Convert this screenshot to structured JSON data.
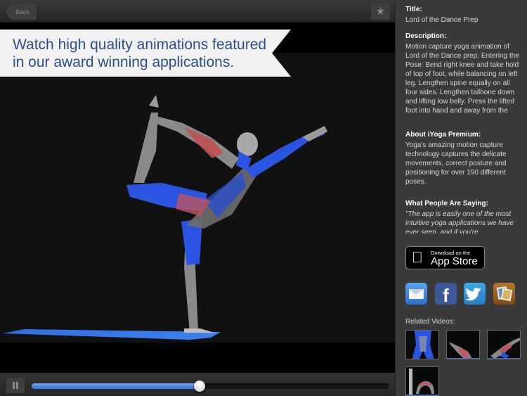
{
  "topbar": {
    "back_label": "Back",
    "favorite_icon": "star-icon",
    "favorite_glyph": "★"
  },
  "banner": {
    "text": "Watch high quality animations featured in our award winning applications."
  },
  "player": {
    "pause_icon": "pause-icon",
    "progress_fraction": 0.47,
    "progress_fill_color": "#4a80e0"
  },
  "info": {
    "title_label": "Title:",
    "title_value": "Lord of the Dance Prep",
    "description_label": "Description:",
    "description_value": "Motion capture yoga animation of Lord of the Dance prep. Entering the Pose: Bend right knee and take hold of top of foot, while balancing on left leg. Lengthen spine equally on all four sides. Lengthen tailbone down and lifting low belly. Press the lifted foot into hand and away from the",
    "about_label": "About iYoga Premium:",
    "about_value": "Yoga's amazing motion capture technology captures the delicate movements, correct posture and positioning for over 190 different poses.",
    "reviews_label": "What People Are Saying:",
    "reviews_value": "\"The app is easily one of the most intuitive yoga applications we have ever seen, and if you're"
  },
  "appstore": {
    "icon": "apple-icon",
    "glyph": "",
    "line1": "Download on the",
    "line2": "App Store"
  },
  "share": [
    {
      "name": "mail",
      "icon": "mail-icon"
    },
    {
      "name": "facebook",
      "icon": "facebook-icon",
      "glyph": "f"
    },
    {
      "name": "twitter",
      "icon": "twitter-icon",
      "glyph": "🐦"
    },
    {
      "name": "photos",
      "icon": "photos-icon"
    }
  ],
  "related": {
    "label": "Related Videos:",
    "items": [
      {
        "pose": "standing forward bend (rear view)"
      },
      {
        "pose": "side bend kneeling"
      },
      {
        "pose": "side angle lunge"
      },
      {
        "pose": "wheel backbend"
      }
    ]
  }
}
